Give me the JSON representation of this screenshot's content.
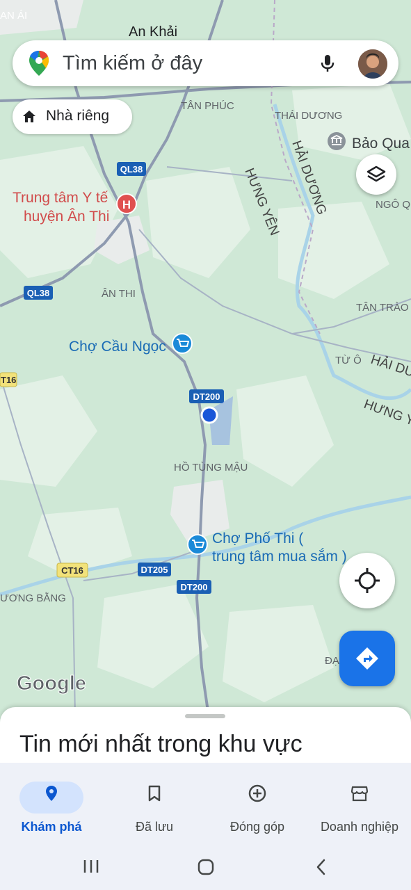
{
  "search": {
    "placeholder": "Tìm kiếm ở đây"
  },
  "chip": {
    "label": "Nhà riêng"
  },
  "map": {
    "places": {
      "an_khai": "An Khải",
      "an_ai": "AN ÁI",
      "tan_phuc": "TÂN PHÚC",
      "thai_duong": "THÁI DƯƠNG",
      "bao_qua": "Bảo Qua",
      "hai_duong_prov": "HẢI DƯƠNG",
      "hung_yen_prov": "HƯNG YÊN",
      "ngo_q": "NGÔ Q",
      "hospital_line1": "Trung tâm Y tế",
      "hospital_line2": "huyện Ân Thi",
      "an_thi": "ÂN THI",
      "tan_trao": "TÂN TRÀO",
      "cho_cau_ngoc": "Chợ Cầu Ngọc",
      "tu_o": "TỪ Ô",
      "hai_du": "HẢI DU",
      "hung_y": "HƯNG Y",
      "ho_tung_mau": "HỒ TÙNG MẬU",
      "cho_pho_thi_line1": "Chợ Phố Thi (",
      "cho_pho_thi_line2": "trung tâm mua sắm )",
      "uong_bang": "ƯƠNG BẰNG",
      "dai": "ĐẠ",
      "google": "Google"
    },
    "roads": {
      "ql38_a": "QL38",
      "ql38_b": "QL38",
      "t16": "T16",
      "dt200_a": "DT200",
      "ct16": "CT16",
      "dt205": "DT205",
      "dt200_b": "DT200"
    }
  },
  "sheet": {
    "title": "Tin mới nhất trong khu vực"
  },
  "nav": [
    {
      "label": "Khám phá",
      "icon": "explore-pin-icon",
      "active": true
    },
    {
      "label": "Đã lưu",
      "icon": "bookmark-icon",
      "active": false
    },
    {
      "label": "Đóng góp",
      "icon": "add-circle-icon",
      "active": false
    },
    {
      "label": "Doanh nghiệp",
      "icon": "storefront-icon",
      "active": false
    }
  ],
  "colors": {
    "accent": "#1a73e8",
    "hospital": "#e05050",
    "shop": "#1a8ad8",
    "road_label": "#1a5fb4",
    "map_green": "#cfe8d6"
  }
}
